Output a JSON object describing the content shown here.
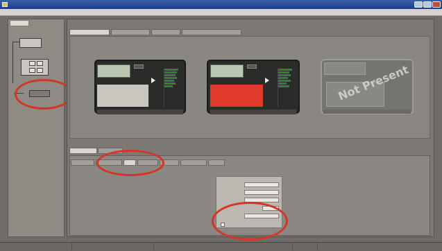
{
  "window": {
    "title": ""
  },
  "menu": [
    {
      "label": ""
    },
    {
      "label": ""
    },
    {
      "label": ""
    },
    {
      "label": ""
    }
  ],
  "left_panel": {
    "tab_label": "",
    "device_a_label": "",
    "device_b_label": "",
    "device_c_label": ""
  },
  "top_tabs": [
    {
      "label": ""
    },
    {
      "label": ""
    },
    {
      "label": ""
    },
    {
      "label": ""
    }
  ],
  "cards": [
    {
      "lcd_text": "",
      "status": "",
      "footer": "",
      "status_color": "#c8c6bf"
    },
    {
      "lcd_text": "",
      "status": "",
      "footer": "",
      "status_color": "#e03a2a"
    },
    {
      "watermark": "Not Present",
      "footer": ""
    }
  ],
  "bottom_tabs_row1": [
    {
      "label": ""
    },
    {
      "label": ""
    }
  ],
  "bottom_tabs_row2": [
    {
      "label": ""
    },
    {
      "label": ""
    },
    {
      "label": ""
    },
    {
      "label": ""
    },
    {
      "label": ""
    },
    {
      "label": ""
    },
    {
      "label": ""
    }
  ],
  "network_panel": {
    "group_label": "",
    "fields": [
      {
        "label": "",
        "value": ""
      },
      {
        "label": "",
        "value": ""
      },
      {
        "label": "",
        "value": ""
      },
      {
        "label": "",
        "value": ""
      },
      {
        "label": "",
        "value": ""
      }
    ],
    "checkbox_label": ""
  },
  "statusbar": [
    {
      "text": ""
    },
    {
      "text": ""
    },
    {
      "text": ""
    },
    {
      "text": ""
    }
  ],
  "colors": {
    "highlight_ring": "#d63424",
    "meter_green": "#3a7a3f"
  }
}
